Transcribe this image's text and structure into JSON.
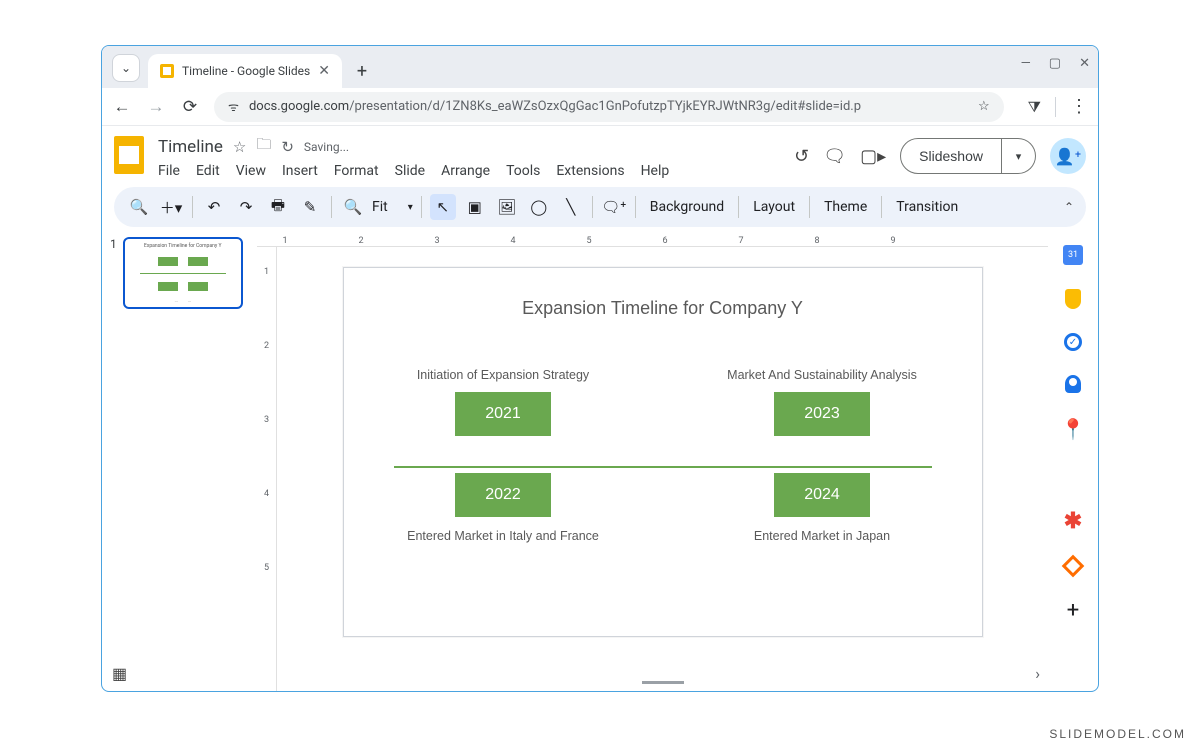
{
  "browser": {
    "tab_title": "Timeline - Google Slides",
    "host": "docs.google.com",
    "path": "/presentation/d/1ZN8Ks_eaWZsOzxQgGac1GnPofutzpTYjkEYRJWtNR3g/edit#slide=id.p"
  },
  "app": {
    "doc_title": "Timeline",
    "saving_label": "Saving...",
    "menus": [
      "File",
      "Edit",
      "View",
      "Insert",
      "Format",
      "Slide",
      "Arrange",
      "Tools",
      "Extensions",
      "Help"
    ],
    "slideshow_label": "Slideshow",
    "share_icon": "+"
  },
  "toolbar": {
    "fit_label": "Fit",
    "background_label": "Background",
    "layout_label": "Layout",
    "theme_label": "Theme",
    "transition_label": "Transition"
  },
  "ruler_h": [
    "1",
    "2",
    "3",
    "4",
    "5",
    "6",
    "7",
    "8",
    "9"
  ],
  "ruler_v": [
    "1",
    "2",
    "3",
    "4",
    "5"
  ],
  "thumb_number": "1",
  "slide": {
    "title": "Expansion Timeline for Company Y",
    "items": [
      {
        "year": "2021",
        "label": "Initiation of Expansion Strategy",
        "pos": "top"
      },
      {
        "year": "2023",
        "label": "Market And Sustainability Analysis",
        "pos": "top"
      },
      {
        "year": "2022",
        "label": "Entered Market in Italy and France",
        "pos": "bottom"
      },
      {
        "year": "2024",
        "label": "Entered Market in Japan",
        "pos": "bottom"
      }
    ]
  },
  "sidepanel": {
    "calendar_day": "31"
  },
  "watermark": "SLIDEMODEL.COM"
}
